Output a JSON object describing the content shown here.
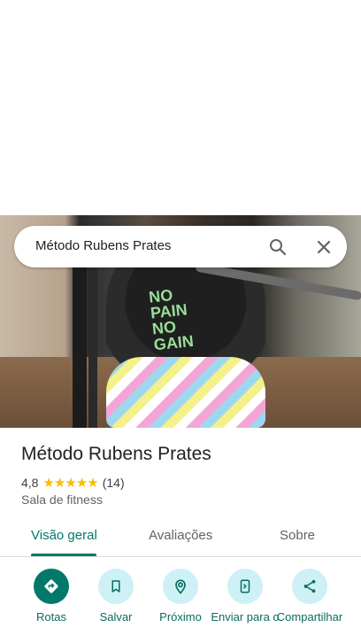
{
  "search": {
    "query": "Método Rubens Prates"
  },
  "place": {
    "name": "Método Rubens Prates",
    "rating": "4,8",
    "stars": "★★★★★",
    "reviews_count": "(14)",
    "category": "Sala de fitness"
  },
  "photo": {
    "overlay_text": "NO PAIN NO GAIN"
  },
  "tabs": [
    {
      "label": "Visão geral",
      "active": true
    },
    {
      "label": "Avaliações",
      "active": false
    },
    {
      "label": "Sobre",
      "active": false
    }
  ],
  "actions": [
    {
      "label": "Rotas",
      "icon": "directions-icon"
    },
    {
      "label": "Salvar",
      "icon": "bookmark-icon"
    },
    {
      "label": "Próximo",
      "icon": "nearby-icon"
    },
    {
      "label": "Enviar para o",
      "icon": "send-to-phone-icon"
    },
    {
      "label": "Compartilhar",
      "icon": "share-icon"
    }
  ],
  "colors": {
    "accent": "#00796b",
    "star": "#fbbc04",
    "chip_bg": "#cdf1f5"
  }
}
